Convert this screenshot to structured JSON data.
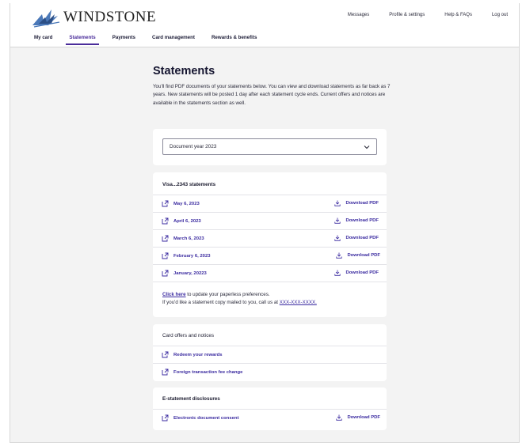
{
  "brand": {
    "name": "WINDSTONE"
  },
  "utility_nav": [
    {
      "label": "Messages"
    },
    {
      "label": "Profile & settings"
    },
    {
      "label": "Help & FAQs"
    },
    {
      "label": "Log out"
    }
  ],
  "main_nav": [
    {
      "label": "My card"
    },
    {
      "label": "Statements"
    },
    {
      "label": "Payments"
    },
    {
      "label": "Card management"
    },
    {
      "label": "Rewards & benefits"
    }
  ],
  "active_tab": "Statements",
  "page": {
    "title": "Statements",
    "intro": "You'll find PDF documents of your statements below. You can view and download statements as far back as 7 years. New statements will be posted 1 day after each statement cycle ends. Current offers and notices are available in the statements section as well."
  },
  "year_select": {
    "value": "Document year 2023"
  },
  "statements": {
    "heading": "Visa...2343 statements",
    "download_label": "Download PDF",
    "items": [
      {
        "label": "May 6, 2023"
      },
      {
        "label": "April 6, 2023"
      },
      {
        "label": "March 6, 2023"
      },
      {
        "label": "February 6, 2023"
      },
      {
        "label": "January, 20223"
      }
    ],
    "note_link": "Click here",
    "note_text_1": " to update your paperless preferences.",
    "note_text_2": "If you'd like a statement copy mailed to you, call us at ",
    "phone": "XXX-XXX-XXXX."
  },
  "offers": {
    "heading": "Card offers and notices",
    "items": [
      {
        "label": "Redeem your rewards"
      },
      {
        "label": "Foreign transaction fee change"
      }
    ]
  },
  "disclosures": {
    "heading": "E-statement disclosures",
    "item": "Electronic document consent",
    "download_label": "Download PDF"
  },
  "colors": {
    "accent": "#3b2ba0",
    "brand_blue": "#4a78b8",
    "page_bg": "#f3f3f3"
  }
}
